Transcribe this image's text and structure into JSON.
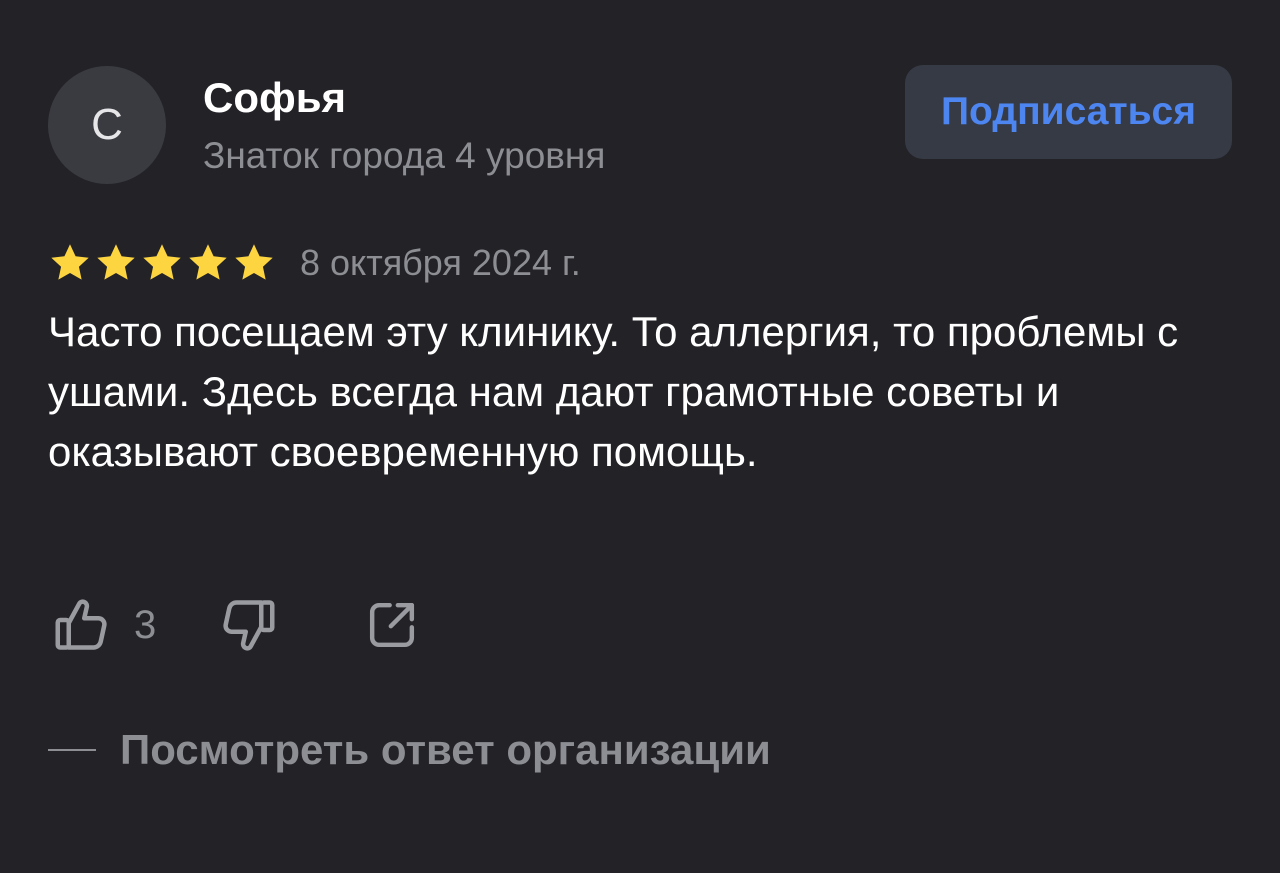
{
  "author": {
    "avatar_letter": "С",
    "name": "Софья",
    "level": "Знаток города 4 уровня"
  },
  "subscribe_button": {
    "label": "Подписаться",
    "color": "#4d86f0"
  },
  "rating": {
    "stars": 5,
    "max_stars": 5,
    "star_color": "#fcd540",
    "date": "8 октября 2024 г."
  },
  "review": {
    "text": "Часто посещаем эту клинику. То аллергия, то проблемы с ушами. Здесь всегда нам дают грамотные советы и оказывают своевременную помощь."
  },
  "actions": {
    "like_icon": "thumbs-up-icon",
    "like_count": "3",
    "dislike_icon": "thumbs-down-icon",
    "share_icon": "share-icon"
  },
  "org_reply": {
    "label": "Посмотреть ответ организации"
  },
  "colors": {
    "background": "#222227",
    "secondary_text": "#8d8e93",
    "button_background": "#363a45"
  }
}
